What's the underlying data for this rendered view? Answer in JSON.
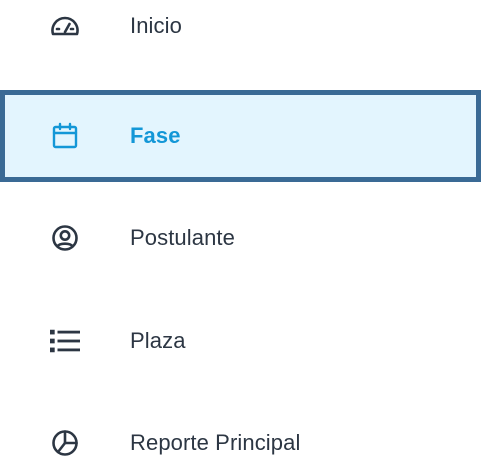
{
  "sidebar": {
    "active_color": "#1397d7",
    "active_bg": "#e3f5fe",
    "active_border": "#3a6a95",
    "text_color": "#2c3643",
    "items": [
      {
        "label": "Inicio",
        "icon": "dashboard-gauge-icon",
        "active": false
      },
      {
        "label": "Fase",
        "icon": "calendar-icon",
        "active": true
      },
      {
        "label": "Postulante",
        "icon": "user-circle-icon",
        "active": false
      },
      {
        "label": "Plaza",
        "icon": "list-icon",
        "active": false
      },
      {
        "label": "Reporte Principal",
        "icon": "pie-chart-icon",
        "active": false
      }
    ]
  }
}
